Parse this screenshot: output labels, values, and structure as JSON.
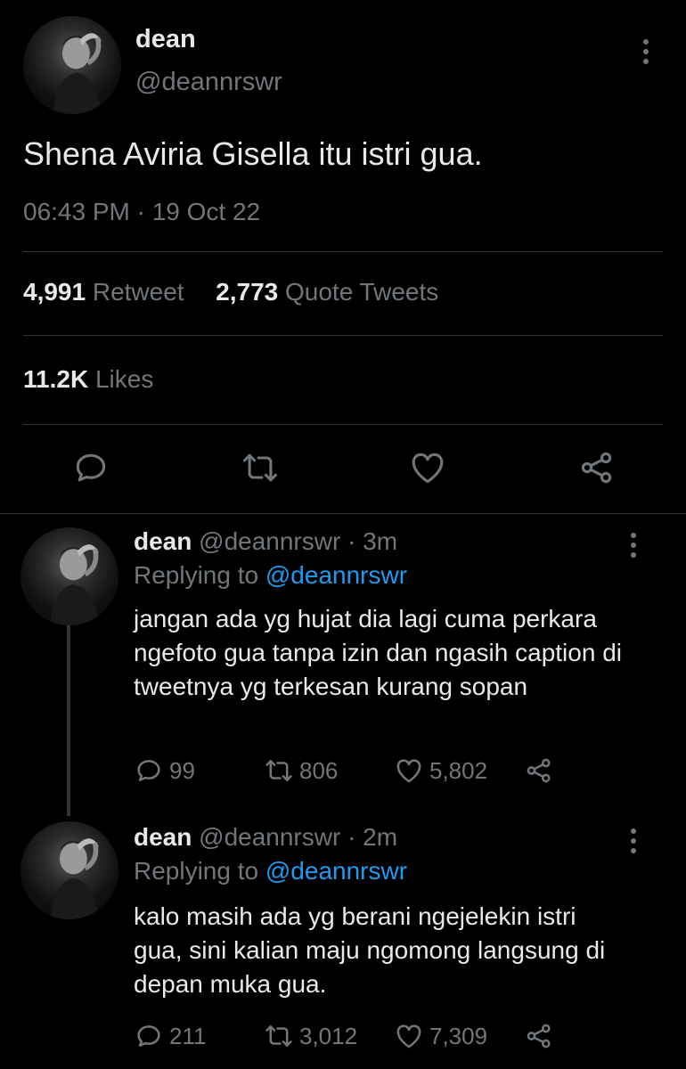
{
  "main_tweet": {
    "author_name": "dean",
    "author_handle": "@deannrswr",
    "text": "Shena Aviria Gisella itu istri gua.",
    "timestamp": "06:43 PM · 19 Oct 22",
    "retweets_count": "4,991",
    "retweets_label": "Retweet",
    "quotes_count": "2,773",
    "quotes_label": "Quote Tweets",
    "likes_count": "11.2K",
    "likes_label": "Likes"
  },
  "replies": [
    {
      "author_name": "dean",
      "author_handle": "@deannrswr",
      "time": "· 3m",
      "replying_prefix": "Replying to",
      "replying_handle": "@deannrswr",
      "text": "jangan ada yg hujat dia lagi cuma perkara ngefoto gua tanpa izin dan ngasih caption di tweetnya yg terkesan kurang sopan",
      "reply_count": "99",
      "retweet_count": "806",
      "like_count": "5,802"
    },
    {
      "author_name": "dean",
      "author_handle": "@deannrswr",
      "time": "· 2m",
      "replying_prefix": "Replying to",
      "replying_handle": "@deannrswr",
      "text": "kalo masih ada yg berani ngejelekin istri gua, sini kalian maju ngomong langsung di depan muka gua.",
      "reply_count": "211",
      "retweet_count": "3,012",
      "like_count": "7,309"
    }
  ],
  "icons": {
    "reply": "reply-icon",
    "retweet": "retweet-icon",
    "like": "heart-icon",
    "share": "share-icon",
    "more": "more-options-icon"
  }
}
